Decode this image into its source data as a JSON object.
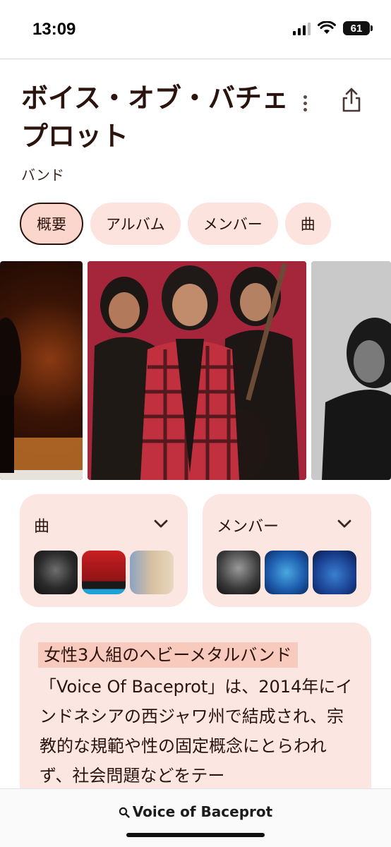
{
  "status_bar": {
    "time": "13:09",
    "battery": "61"
  },
  "header": {
    "title": "ボイス・オブ・バチェプロット",
    "subtitle": "バンド"
  },
  "chips": [
    {
      "label": "概要",
      "active": true
    },
    {
      "label": "アルバム",
      "active": false
    },
    {
      "label": "メンバー",
      "active": false
    },
    {
      "label": "曲",
      "active": false
    }
  ],
  "cards": {
    "songs": {
      "title": "曲"
    },
    "members": {
      "title": "メンバー"
    }
  },
  "description": {
    "headline": "女性3人組のヘビーメタルバンド",
    "body": "「Voice Of Baceprot」は、2014年にインドネシアの西ジャワ州で結成され、宗教的な規範や性の固定概念にとらわれず、社会問題などをテー"
  },
  "search": {
    "label": "Voice of Baceprot"
  },
  "icons": {
    "more": "more-vertical-icon",
    "share": "share-icon",
    "chevron": "chevron-down-icon",
    "search": "search-icon"
  },
  "colors": {
    "chip_bg": "#fce3dd",
    "chip_active_bg": "#fbd6cc",
    "card_bg": "#fce6e1",
    "text_dark": "#2b140e",
    "highlight": "#f8c9bd"
  }
}
